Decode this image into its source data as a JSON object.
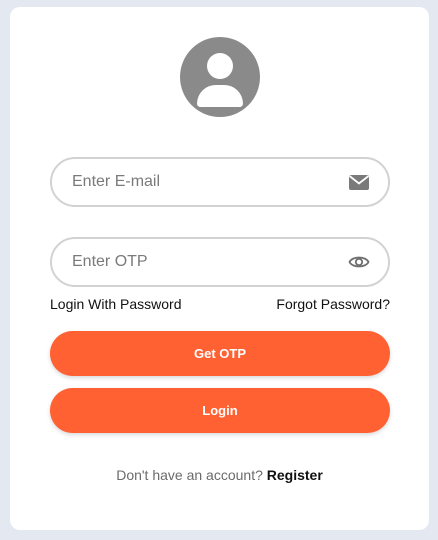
{
  "avatar": {
    "icon": "user-avatar-icon"
  },
  "email": {
    "placeholder": "Enter E-mail",
    "icon": "envelope-icon"
  },
  "otp": {
    "placeholder": "Enter OTP",
    "icon": "eye-icon"
  },
  "links": {
    "login_with_password": "Login With Password",
    "forgot_password": "Forgot Password?"
  },
  "buttons": {
    "get_otp": "Get OTP",
    "login": "Login"
  },
  "footer": {
    "prompt": "Don't have an account? ",
    "register": "Register"
  },
  "colors": {
    "accent": "#ff6133",
    "background": "#e4e9f1",
    "icon_gray": "#8a8a8a"
  }
}
